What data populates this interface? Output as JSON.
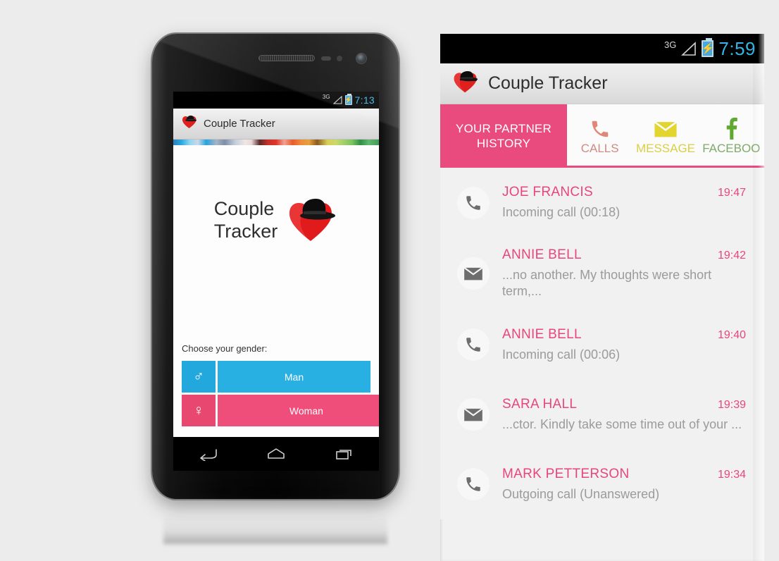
{
  "app_name": "Couple Tracker",
  "colors": {
    "accent_pink": "#ea4b7e",
    "name_pink": "#e8467a",
    "man_blue": "#29b0e2",
    "woman_pink": "#ee4e79",
    "calls_icon": "#e08878",
    "message_icon": "#e3d52f",
    "facebook_icon": "#5fa832",
    "clock_blue": "#33b5e5",
    "page_background": "#ececec"
  },
  "phone_mockup": {
    "status_bar": {
      "network": "3G",
      "battery_icon": "charging-battery",
      "clock": "7:13"
    },
    "action_bar": {
      "icon": "couple-tracker-heart-hat-logo",
      "title": "Couple Tracker"
    },
    "splash": {
      "logo_line1": "Couple",
      "logo_line2": "Tracker",
      "logo_icon": "heart-with-fedora-hat"
    },
    "gender": {
      "label": "Choose your gender:",
      "options": [
        {
          "id": "man",
          "symbol": "♂",
          "label": "Man"
        },
        {
          "id": "woman",
          "symbol": "♀",
          "label": "Woman"
        }
      ]
    },
    "nav_bar": {
      "back": "back-icon",
      "home": "home-icon",
      "recents": "recents-icon"
    }
  },
  "app_panel": {
    "status_bar": {
      "network": "3G",
      "battery_icon": "charging-battery",
      "clock": "7:59"
    },
    "action_bar": {
      "icon": "couple-tracker-heart-hat-logo",
      "title": "Couple Tracker"
    },
    "tabs": {
      "active": {
        "line1": "YOUR PARTNER",
        "line2": "HISTORY"
      },
      "items": [
        {
          "id": "calls",
          "label": "CALLS",
          "icon": "phone-icon"
        },
        {
          "id": "message",
          "label": "MESSAGE",
          "icon": "envelope-icon"
        },
        {
          "id": "facebook",
          "label": "FACEBOO",
          "icon": "facebook-f-icon"
        }
      ]
    },
    "history": [
      {
        "icon": "phone-icon",
        "name": "JOE FRANCIS",
        "time": "19:47",
        "detail": "Incoming call (00:18)"
      },
      {
        "icon": "envelope-icon",
        "name": "ANNIE BELL",
        "time": "19:42",
        "detail": "...no another. My thoughts were short term,..."
      },
      {
        "icon": "phone-icon",
        "name": "ANNIE BELL",
        "time": "19:40",
        "detail": "Incoming call (00:06)"
      },
      {
        "icon": "envelope-icon",
        "name": "SARA HALL",
        "time": "19:39",
        "detail": "...ctor. Kindly take some time out of your ..."
      },
      {
        "icon": "phone-icon",
        "name": "MARK PETTERSON",
        "time": "19:34",
        "detail": "Outgoing call (Unanswered)"
      }
    ]
  }
}
